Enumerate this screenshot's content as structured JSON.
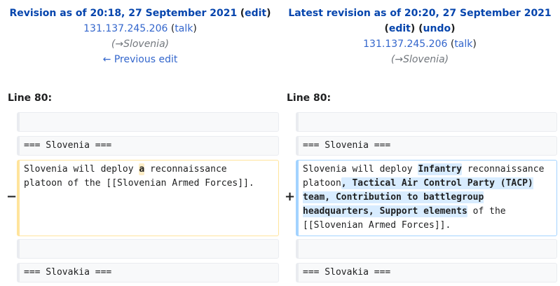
{
  "left_header": {
    "title_prefix": "Revision as of 20:18, 27 September 2021",
    "edit_label": "edit",
    "user": "131.137.245.206",
    "talk_label": "talk",
    "comment_arrow": "→",
    "comment_section": "Slovenia",
    "prev_edit": "← Previous edit"
  },
  "right_header": {
    "title_prefix": "Latest revision as of 20:20, 27 September 2021",
    "edit_label": "edit",
    "undo_label": "undo",
    "user": "131.137.245.206",
    "talk_label": "talk",
    "comment_arrow": "→",
    "comment_section": "Slovenia"
  },
  "line_label": "Line 80:",
  "diff": {
    "heading_slovenia": "=== Slovenia ===",
    "heading_slovakia": "=== Slovakia ===",
    "old": {
      "marker": "−",
      "before": "Slovenia will deploy ",
      "removed": "a",
      "after": " reconnaissance\nplatoon of the [[Slovenian Armed Forces]]."
    },
    "new": {
      "marker": "+",
      "before": "Slovenia will deploy ",
      "added1": "Infantry",
      "middle": " reconnaissance\nplatoon",
      "added2": ", Tactical Air Control Party (TACP)\nteam, Contribution to battlegroup\nheadquarters, Support elements",
      "after": " of the\n[[Slovenian Armed Forces]]."
    }
  }
}
